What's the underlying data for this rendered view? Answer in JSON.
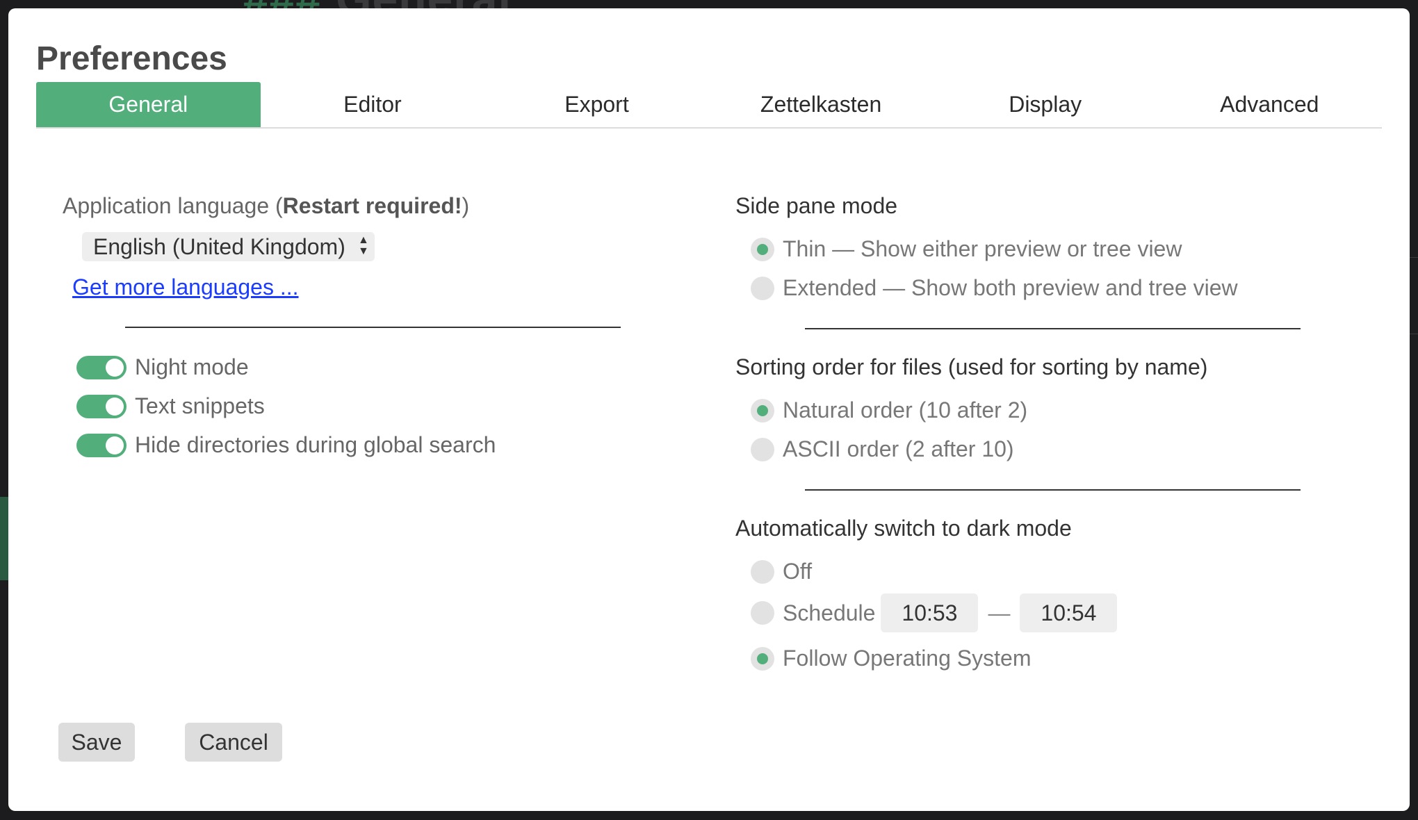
{
  "background": {
    "heading": "General",
    "heading_icon": "hash-icon"
  },
  "dialog": {
    "title": "Preferences",
    "tabs": [
      {
        "label": "General",
        "active": true
      },
      {
        "label": "Editor",
        "active": false
      },
      {
        "label": "Export",
        "active": false
      },
      {
        "label": "Zettelkasten",
        "active": false
      },
      {
        "label": "Display",
        "active": false
      },
      {
        "label": "Advanced",
        "active": false
      }
    ],
    "accent_color": "#52ae7a"
  },
  "general": {
    "language_label": "Application language (",
    "language_label_bold": "Restart required!",
    "language_label_end": ")",
    "language_value": "English (United Kingdom)",
    "more_languages_link": "Get more languages ...",
    "toggles": [
      {
        "label": "Night mode",
        "checked": true
      },
      {
        "label": "Text snippets",
        "checked": true
      },
      {
        "label": "Hide directories during global search",
        "checked": true
      }
    ],
    "side_pane": {
      "title": "Side pane mode",
      "options": [
        {
          "label": "Thin — Show either preview or tree view",
          "selected": true
        },
        {
          "label": "Extended — Show both preview and tree view",
          "selected": false
        }
      ]
    },
    "sorting": {
      "title": "Sorting order for files (used for sorting by name)",
      "options": [
        {
          "label": "Natural order (10 after 2)",
          "selected": true
        },
        {
          "label": "ASCII order (2 after 10)",
          "selected": false
        }
      ]
    },
    "dark_mode": {
      "title": "Automatically switch to dark mode",
      "off_label": "Off",
      "schedule_label": "Schedule",
      "start_time": "10:53",
      "separator": "—",
      "end_time": "10:54",
      "follow_os_label": "Follow Operating System",
      "selected": "follow_os"
    }
  },
  "buttons": {
    "save": "Save",
    "cancel": "Cancel"
  }
}
